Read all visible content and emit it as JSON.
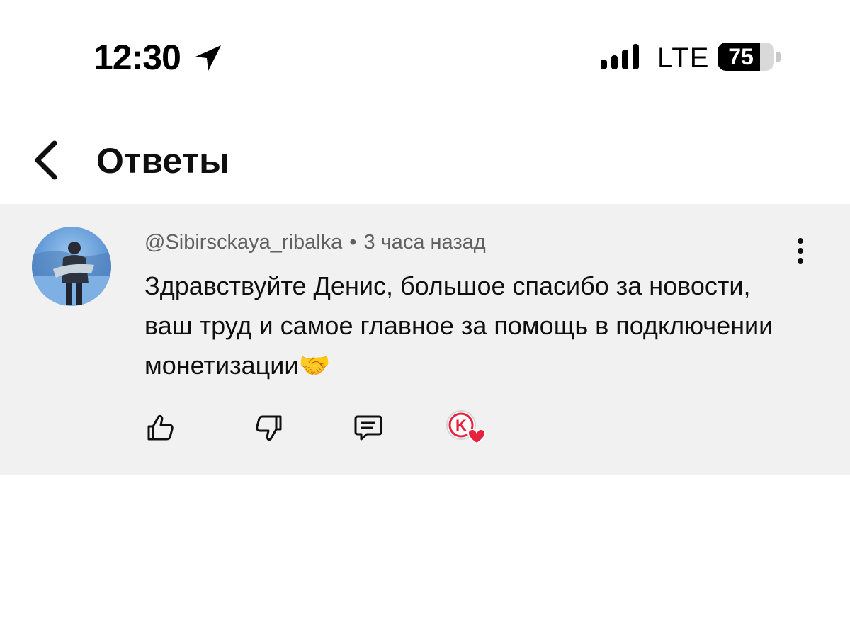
{
  "status_bar": {
    "time": "12:30",
    "network": "LTE",
    "battery_level": "75",
    "battery_fraction": 0.75
  },
  "header": {
    "title": "Ответы",
    "back_icon": "chevron-left-icon"
  },
  "comment": {
    "author": "@Sibirsckaya_ribalka",
    "separator": "•",
    "time": "3 часа назад",
    "text": "Здравствуйте Денис, большое спасибо за новости, ваш труд  и самое главное за помощь в подключении монетизации🤝",
    "actions": {
      "like_icon": "thumbs-up-icon",
      "dislike_icon": "thumbs-down-icon",
      "reply_icon": "comment-reply-icon",
      "creator_heart_icon": "creator-heart-icon"
    },
    "creator_badge_letter": "K"
  },
  "colors": {
    "card_background": "#f1f1f1",
    "text_primary": "#0f0f0f",
    "text_secondary": "#606060",
    "heart": "#e8213d"
  }
}
